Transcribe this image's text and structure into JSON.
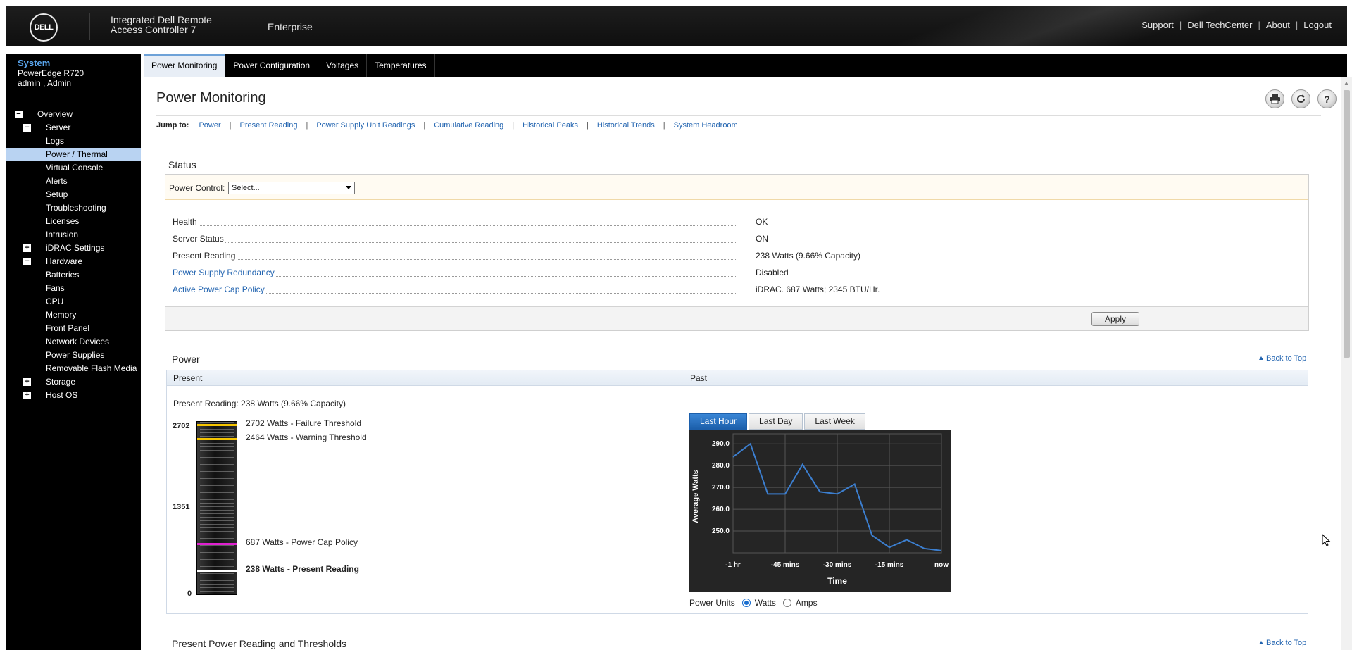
{
  "header": {
    "logo_text": "DELL",
    "product_line1": "Integrated Dell Remote",
    "product_line2": "Access Controller 7",
    "edition": "Enterprise",
    "links": [
      "Support",
      "Dell TechCenter",
      "About",
      "Logout"
    ],
    "link_separator": "|"
  },
  "sidebar": {
    "system_title": "System",
    "model": "PowerEdge R720",
    "user": "admin , Admin",
    "tree": [
      {
        "label": "Overview",
        "level": 0,
        "toggle": "−"
      },
      {
        "label": "Server",
        "level": 1,
        "toggle": "−"
      },
      {
        "label": "Logs",
        "level": 2
      },
      {
        "label": "Power / Thermal",
        "level": 2,
        "active": true
      },
      {
        "label": "Virtual Console",
        "level": 2
      },
      {
        "label": "Alerts",
        "level": 2
      },
      {
        "label": "Setup",
        "level": 2
      },
      {
        "label": "Troubleshooting",
        "level": 2
      },
      {
        "label": "Licenses",
        "level": 2
      },
      {
        "label": "Intrusion",
        "level": 2
      },
      {
        "label": "iDRAC Settings",
        "level": 1,
        "toggle": "+"
      },
      {
        "label": "Hardware",
        "level": 1,
        "toggle": "−"
      },
      {
        "label": "Batteries",
        "level": 2
      },
      {
        "label": "Fans",
        "level": 2
      },
      {
        "label": "CPU",
        "level": 2
      },
      {
        "label": "Memory",
        "level": 2
      },
      {
        "label": "Front Panel",
        "level": 2
      },
      {
        "label": "Network Devices",
        "level": 2
      },
      {
        "label": "Power Supplies",
        "level": 2
      },
      {
        "label": "Removable Flash Media",
        "level": 2
      },
      {
        "label": "Storage",
        "level": 1,
        "toggle": "+"
      },
      {
        "label": "Host OS",
        "level": 1,
        "toggle": "+"
      }
    ]
  },
  "tabs": [
    {
      "label": "Power Monitoring",
      "active": true
    },
    {
      "label": "Power Configuration"
    },
    {
      "label": "Voltages"
    },
    {
      "label": "Temperatures"
    }
  ],
  "page": {
    "title": "Power Monitoring",
    "icons": [
      "print-icon",
      "refresh-icon",
      "help-icon"
    ],
    "jump_label": "Jump to:",
    "jump_links": [
      "Power",
      "Present Reading",
      "Power Supply Unit Readings",
      "Cumulative Reading",
      "Historical Peaks",
      "Historical Trends",
      "System Headroom"
    ],
    "jump_separator": "|"
  },
  "status": {
    "title": "Status",
    "power_control_label": "Power Control:",
    "power_control_value": "Select...",
    "rows": [
      {
        "label": "Health",
        "value": "OK",
        "link": false
      },
      {
        "label": "Server Status",
        "value": "ON",
        "link": false
      },
      {
        "label": "Present Reading",
        "value": "238 Watts (9.66% Capacity)",
        "link": false
      },
      {
        "label": "Power Supply Redundancy",
        "value": "Disabled",
        "link": true
      },
      {
        "label": "Active Power Cap Policy",
        "value": "iDRAC. 687 Watts; 2345 BTU/Hr.",
        "link": true
      }
    ],
    "apply_label": "Apply"
  },
  "power": {
    "title": "Power",
    "back_to_top": "Back to Top",
    "col_present": "Present",
    "col_past": "Past",
    "present_reading_text": "Present Reading: 238 Watts (9.66% Capacity)",
    "gauge": {
      "max": 2702,
      "mid": 1351,
      "min": 0,
      "max_label": "2702",
      "mid_label": "1351",
      "min_label": "0",
      "markers": [
        {
          "value": 2702,
          "label": "2702 Watts - Failure Threshold",
          "color": "#f5c400",
          "bold": false
        },
        {
          "value": 2464,
          "label": "2464 Watts - Warning Threshold",
          "color": "#f5c400",
          "bold": false
        },
        {
          "value": 687,
          "label": "687 Watts - Power Cap Policy",
          "color": "#e020d0",
          "bold": false
        },
        {
          "value": 238,
          "label": "238 Watts - Present Reading",
          "color": "#ffffff",
          "bold": true
        }
      ]
    },
    "range_tabs": [
      {
        "label": "Last Hour",
        "active": true
      },
      {
        "label": "Last Day"
      },
      {
        "label": "Last Week"
      }
    ],
    "units_label": "Power Units",
    "units": [
      {
        "label": "Watts",
        "selected": true
      },
      {
        "label": "Amps",
        "selected": false
      }
    ]
  },
  "chart_data": {
    "type": "line",
    "xlabel": "Time",
    "ylabel": "Average Watts",
    "categories": [
      "-1 hr",
      "-45 mins",
      "-30 mins",
      "-15 mins",
      "now"
    ],
    "x": [
      -60,
      -55,
      -50,
      -45,
      -40,
      -35,
      -30,
      -25,
      -20,
      -15,
      -10,
      -5,
      0
    ],
    "series": [
      {
        "values": [
          284,
          290,
          267,
          267,
          280.5,
          268,
          267,
          271.5,
          248,
          242.5,
          246,
          242,
          241
        ]
      }
    ],
    "yticks": [
      250.0,
      260.0,
      270.0,
      280.0,
      290.0
    ],
    "ylim": [
      240,
      292
    ],
    "xlim": [
      -60,
      0
    ],
    "grid": true,
    "line_color": "#3c7fd0",
    "background": "#252525"
  },
  "lower": {
    "title": "Present Power Reading and Thresholds",
    "back_to_top": "Back to Top"
  }
}
